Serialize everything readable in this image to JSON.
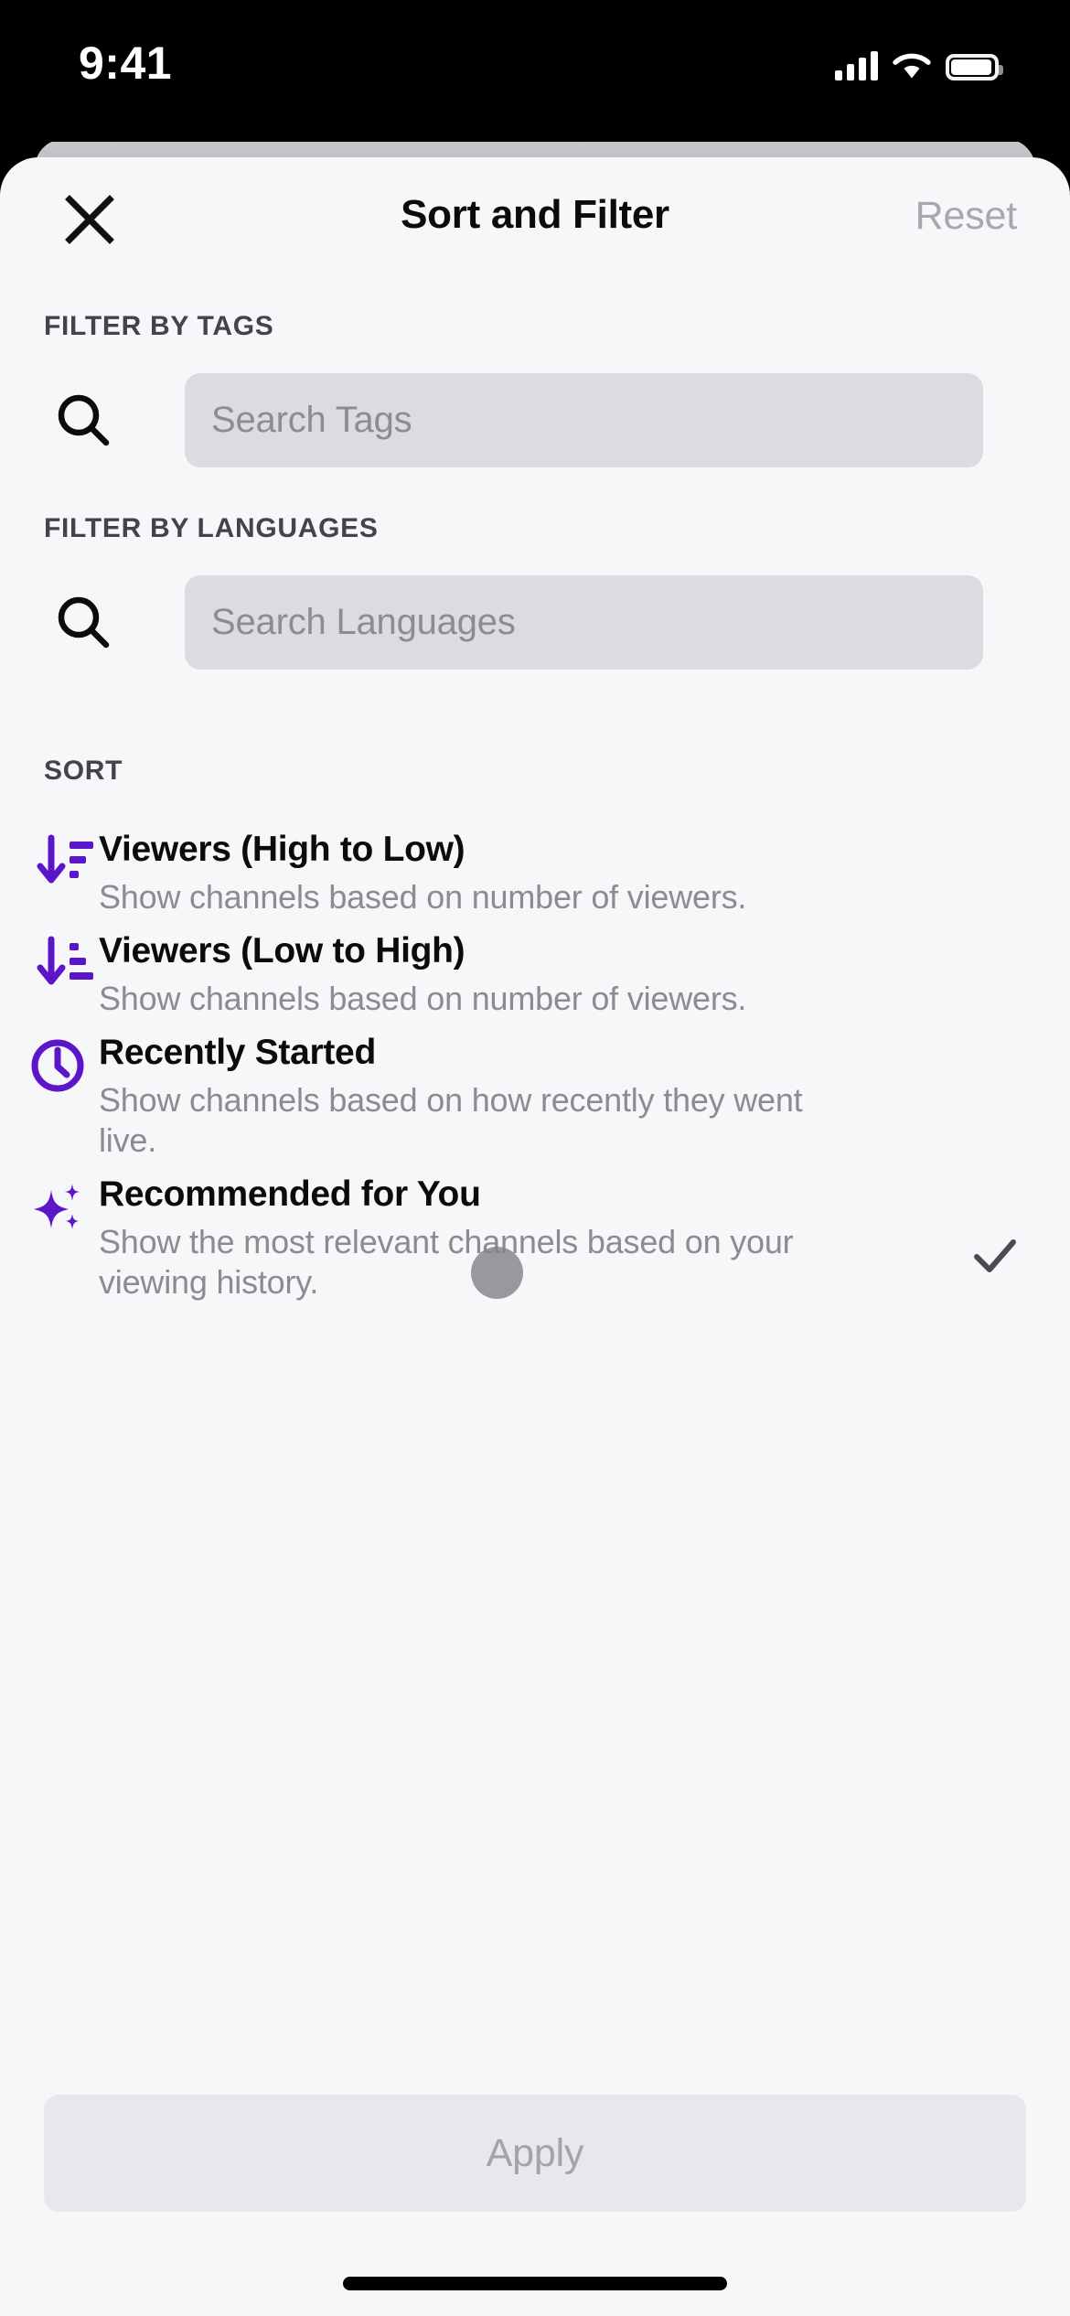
{
  "status_bar": {
    "time": "9:41",
    "cellular_icon": "cellular-signal-icon",
    "wifi_icon": "wifi-icon",
    "battery_icon": "battery-icon"
  },
  "header": {
    "close_icon": "close-x-icon",
    "title": "Sort and Filter",
    "reset_label": "Reset",
    "reset_color": "#A7A7AD"
  },
  "filters": [
    {
      "section_label": "FILTER BY TAGS",
      "search_icon": "search-icon",
      "placeholder": "Search Tags",
      "value": ""
    },
    {
      "section_label": "FILTER BY LANGUAGES",
      "search_icon": "search-icon",
      "placeholder": "Search Languages",
      "value": ""
    }
  ],
  "sort": {
    "section_label": "SORT",
    "accent_color": "#5B16C9",
    "options": [
      {
        "icon": "sort-descending-icon",
        "title": "Viewers (High to Low)",
        "description": "Show channels based on number of viewers.",
        "selected": false
      },
      {
        "icon": "sort-ascending-icon",
        "title": "Viewers (Low to High)",
        "description": "Show channels based on number of viewers.",
        "selected": false
      },
      {
        "icon": "clock-icon",
        "title": "Recently Started",
        "description": "Show channels based on how recently they went live.",
        "selected": false
      },
      {
        "icon": "sparkles-icon",
        "title": "Recommended for You",
        "description": "Show the most relevant channels based on your viewing history.",
        "selected": true,
        "check_icon": "checkmark-icon"
      }
    ]
  },
  "footer": {
    "apply_label": "Apply",
    "apply_enabled": false,
    "home_indicator": "home-indicator"
  }
}
